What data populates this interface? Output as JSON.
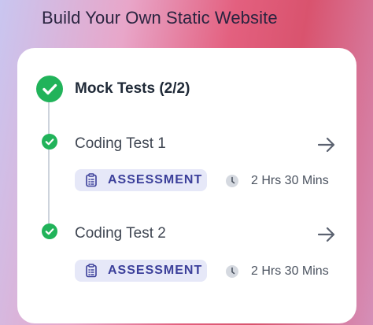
{
  "header": {
    "title": "Build Your Own Static Website"
  },
  "section": {
    "title": "Mock Tests (2/2)",
    "status_icon": "check-circle-icon"
  },
  "tests": [
    {
      "title": "Coding Test 1",
      "badge": "ASSESSMENT",
      "duration": "2 Hrs 30 Mins",
      "completed": true
    },
    {
      "title": "Coding Test 2",
      "badge": "ASSESSMENT",
      "duration": "2 Hrs 30 Mins",
      "completed": true
    }
  ],
  "colors": {
    "success": "#21b35a",
    "badge_bg": "#e6e8f8",
    "badge_text": "#3b3f9a"
  }
}
